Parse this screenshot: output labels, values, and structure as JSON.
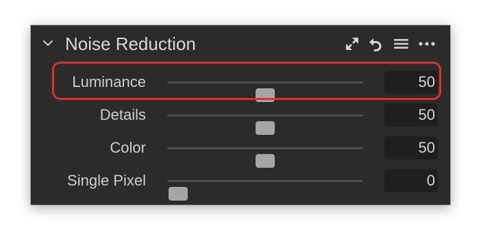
{
  "panel": {
    "title": "Noise Reduction",
    "header_icons": [
      "expand-icon",
      "reset-icon",
      "presets-menu-icon",
      "more-options-icon"
    ],
    "colors": {
      "background": "#2b2b2b",
      "value_field": "#1f1f1f",
      "slider_thumb": "#a6a6a6",
      "highlight": "#e0302b"
    }
  },
  "sliders": [
    {
      "label": "Luminance",
      "value": "50",
      "position": 0.5
    },
    {
      "label": "Details",
      "value": "50",
      "position": 0.5
    },
    {
      "label": "Color",
      "value": "50",
      "position": 0.5
    },
    {
      "label": "Single Pixel",
      "value": "0",
      "position": 0.0
    }
  ],
  "highlighted_row": "Luminance"
}
